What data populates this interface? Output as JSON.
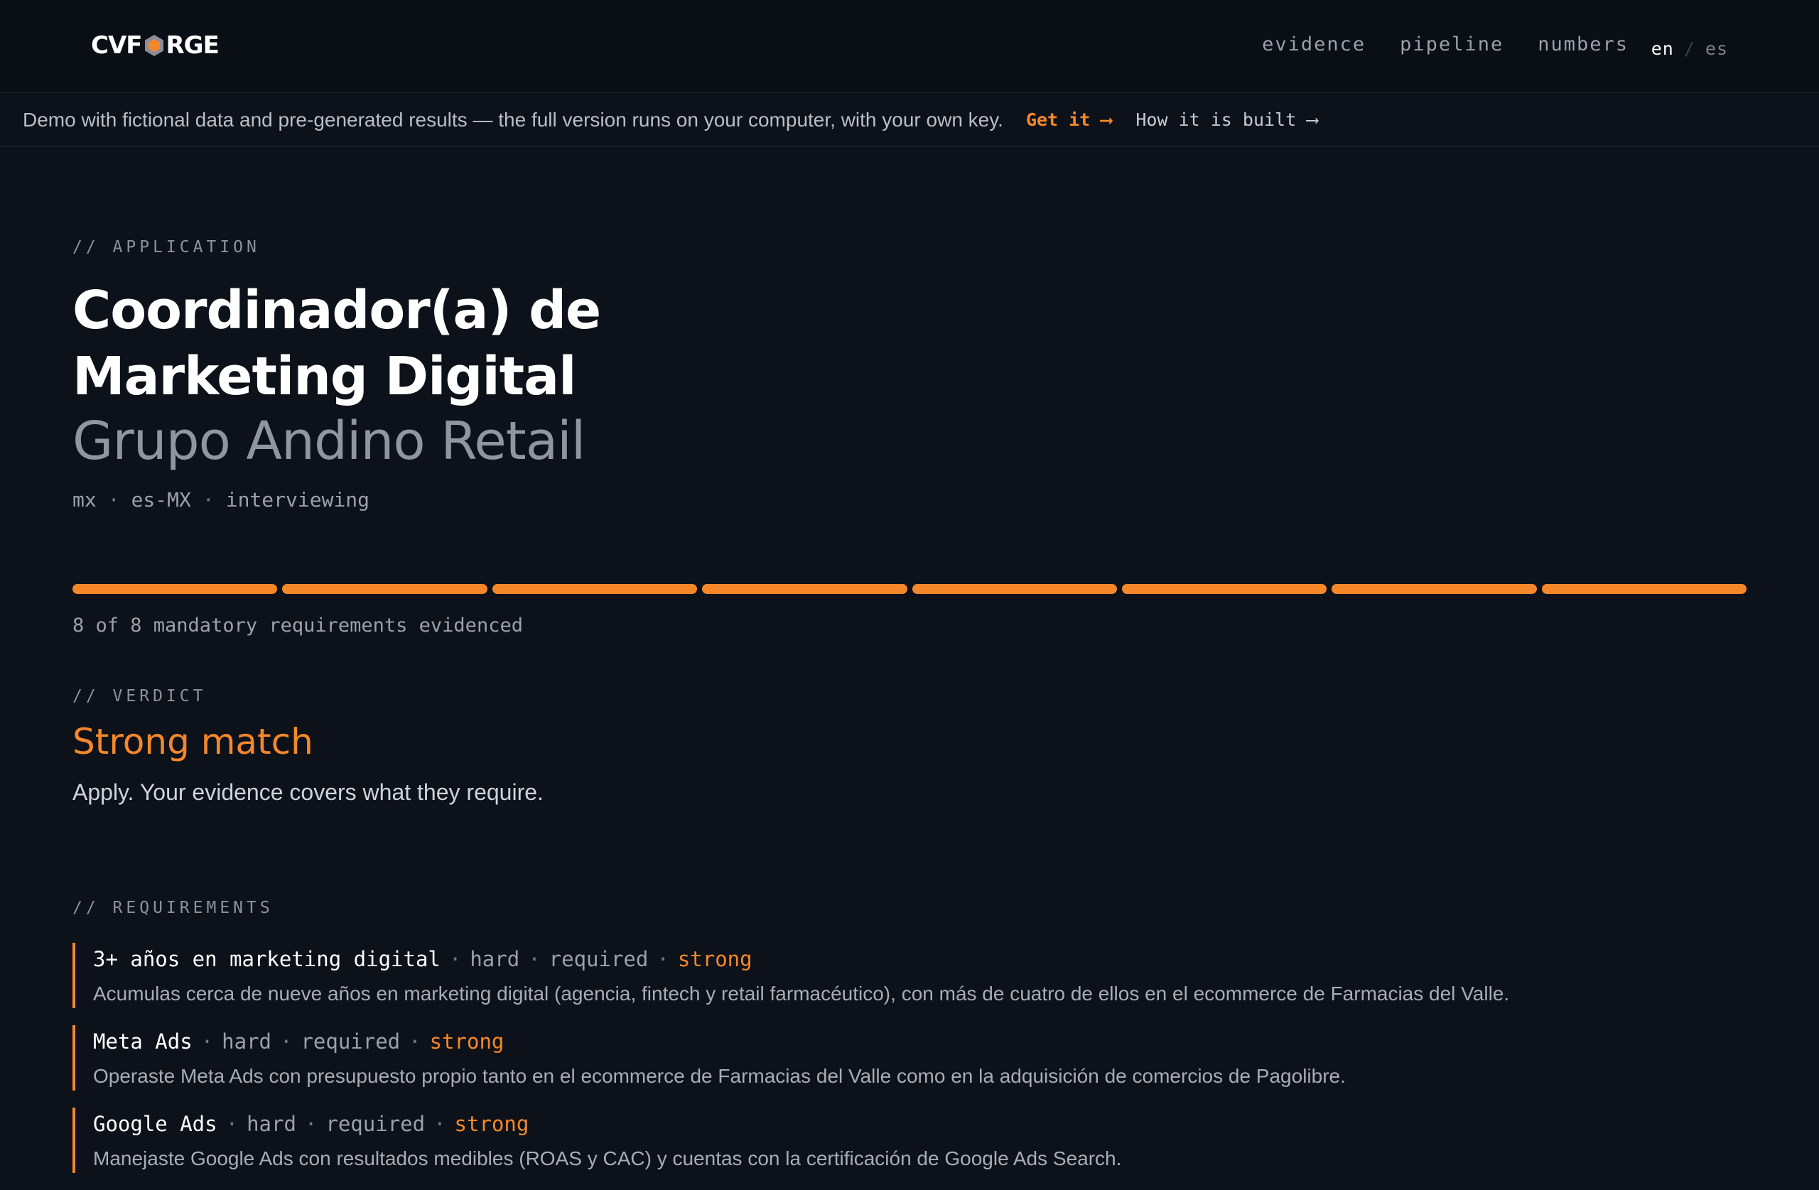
{
  "brand": {
    "logo_left": "CVF",
    "logo_right": "RGE",
    "accent": "#f5872a",
    "logo_icon": "hexagon-icon"
  },
  "nav": {
    "items": [
      {
        "label": "evidence"
      },
      {
        "label": "pipeline"
      },
      {
        "label": "numbers"
      }
    ],
    "lang": {
      "active": "en",
      "separator": "/",
      "inactive": "es"
    }
  },
  "banner": {
    "message": "Demo with fictional data and pre-generated results — the full version runs on your computer, with your own key.",
    "cta_label": "Get it ⟶",
    "how_label": "How it is built ⟶"
  },
  "application": {
    "eyebrow": "// APPLICATION",
    "title_line1": "Coordinador(a) de",
    "title_line2": "Marketing Digital",
    "company": "Grupo Andino Retail",
    "meta": {
      "country": "mx",
      "locale": "es-MX",
      "status": "interviewing"
    }
  },
  "progress": {
    "evidenced": 8,
    "total": 8,
    "text": "8 of 8 mandatory requirements evidenced"
  },
  "verdict": {
    "eyebrow": "// VERDICT",
    "title": "Strong match",
    "text": "Apply. Your evidence covers what they require."
  },
  "requirements": {
    "eyebrow": "// REQUIREMENTS",
    "items": [
      {
        "name": "3+ años en marketing digital",
        "kind": "hard",
        "necessity": "required",
        "strength": "strong",
        "description": "Acumulas cerca de nueve años en marketing digital (agencia, fintech y retail farmacéutico), con más de cuatro de ellos en el ecommerce de Farmacias del Valle."
      },
      {
        "name": "Meta Ads",
        "kind": "hard",
        "necessity": "required",
        "strength": "strong",
        "description": "Operaste Meta Ads con presupuesto propio tanto en el ecommerce de Farmacias del Valle como en la adquisición de comercios de Pagolibre."
      },
      {
        "name": "Google Ads",
        "kind": "hard",
        "necessity": "required",
        "strength": "strong",
        "description": "Manejaste Google Ads con resultados medibles (ROAS y CAC) y cuentas con la certificación de Google Ads Search."
      }
    ]
  }
}
